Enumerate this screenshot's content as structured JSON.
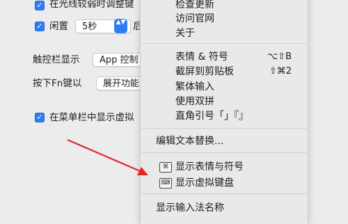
{
  "prefs": {
    "row1_checkbox": "✓",
    "row1_label": "在光线较弱时调整键",
    "row2_checkbox": "✓",
    "row2_label": "闲置",
    "row2_value": "5秒",
    "row2_stepper": "▲▼",
    "row2_suffix": "后",
    "touchbar_label": "触控栏显示",
    "touchbar_value": "App 控制",
    "fn_label": "按下Fn键以",
    "fn_value": "展开功能",
    "menubar_checkbox": "✓",
    "menubar_label": "在菜单栏中显示虚拟"
  },
  "menu": {
    "items": [
      {
        "label": "检查更新"
      },
      {
        "label": "访问官网"
      },
      {
        "label": "关于"
      },
      {
        "label": "表情 & 符号",
        "shortcut": "⌥⇧B"
      },
      {
        "label": "截屏到剪贴板",
        "shortcut": "⇧⌘2"
      },
      {
        "label": "繁体输入"
      },
      {
        "label": "使用双拼"
      },
      {
        "label": "直角引号「」『』"
      },
      {
        "label": "编辑文本替换..."
      },
      {
        "label": "显示表情与符号",
        "icon": "⌘"
      },
      {
        "label": "显示虚拟键盘",
        "icon": "⌨"
      },
      {
        "label": "显示输入法名称"
      }
    ]
  },
  "colors": {
    "accent": "#2f7df6",
    "annotation_arrow": "#e0282b",
    "menu_background": "#e9e9e9"
  }
}
